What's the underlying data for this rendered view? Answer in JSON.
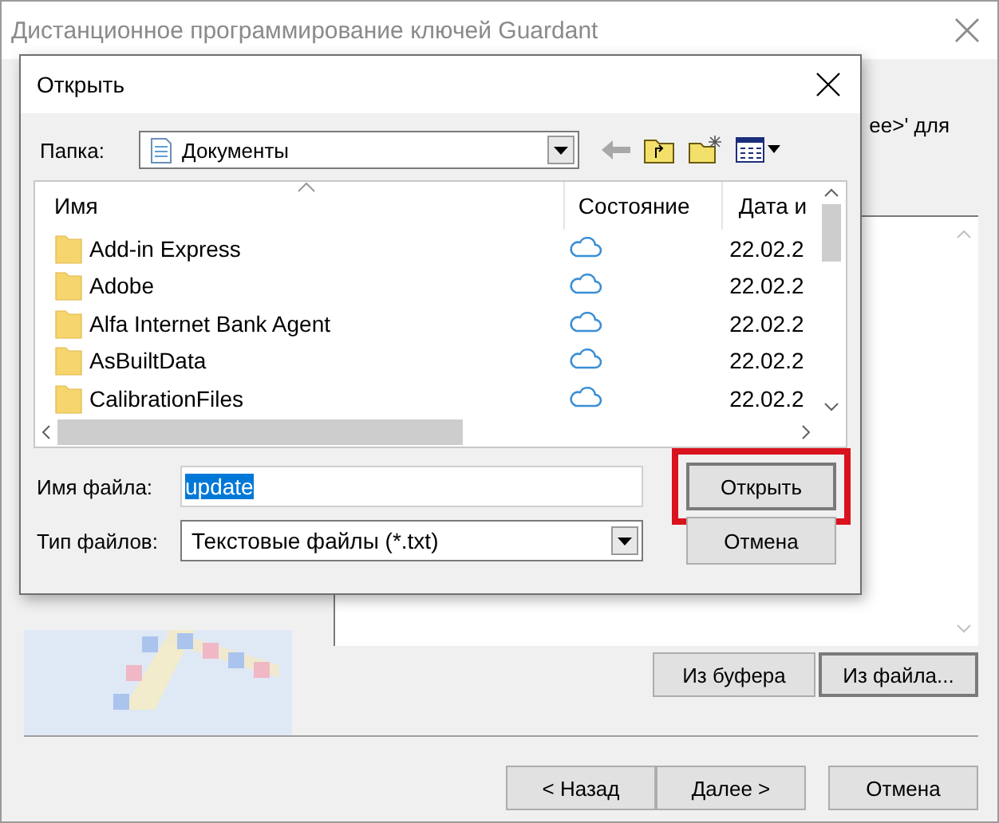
{
  "window": {
    "title": "Дистанционное программирование ключей Guardant"
  },
  "wizard": {
    "instruction_fragment": "ee>' для",
    "source_buttons": [
      {
        "label": "Из буфера",
        "focused": false
      },
      {
        "label": "Из файла...",
        "focused": true
      }
    ],
    "nav_buttons": [
      "< Назад",
      "Далее >",
      "Отмена"
    ]
  },
  "dialog": {
    "title": "Открыть",
    "folder_label": "Папка:",
    "folder": "Документы",
    "columns": [
      "Имя",
      "Состояние",
      "Дата и"
    ],
    "rows": [
      {
        "name": "Add-in Express",
        "kind": "cloud",
        "date": "22.02.2"
      },
      {
        "name": "Adobe",
        "kind": "cloud",
        "date": "22.02.2"
      },
      {
        "name": "Alfa Internet Bank Agent",
        "kind": "cloud",
        "date": "22.02.2"
      },
      {
        "name": "AsBuiltData",
        "kind": "cloud",
        "date": "22.02.2"
      },
      {
        "name": "CalibrationFiles",
        "kind": "cloud",
        "date": "22.02.2"
      }
    ],
    "file_name_label": "Имя файла:",
    "file_name": {
      "value": "update",
      "text_selected": true
    },
    "file_type_label": "Тип файлов:",
    "file_type": "Текстовые файлы (*.txt)",
    "buttons": [
      {
        "label": "Открыть",
        "highlighted": true
      },
      {
        "label": "Отмена",
        "highlighted": false
      }
    ]
  }
}
